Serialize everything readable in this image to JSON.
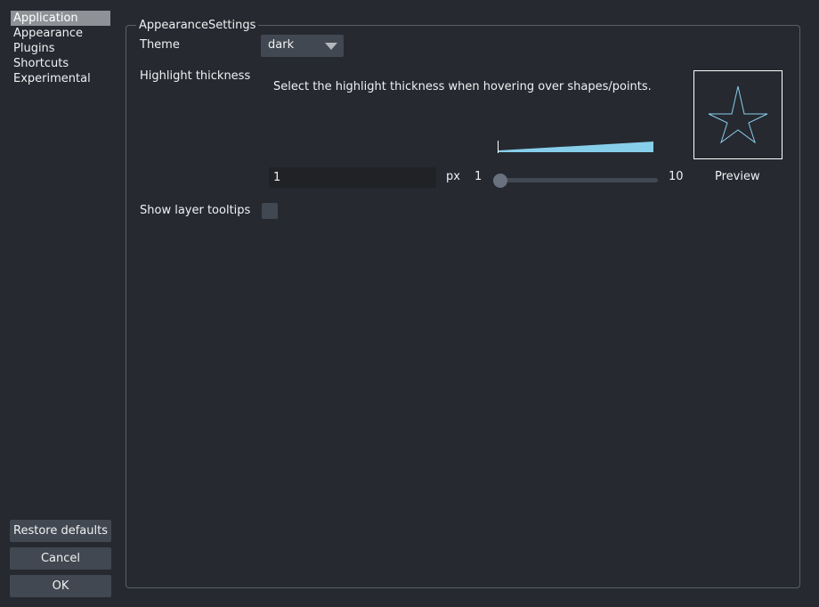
{
  "sidebar": {
    "items": [
      {
        "label": "Application",
        "selected": true
      },
      {
        "label": "Appearance",
        "selected": false
      },
      {
        "label": "Plugins",
        "selected": false
      },
      {
        "label": "Shortcuts",
        "selected": false
      },
      {
        "label": "Experimental",
        "selected": false
      }
    ]
  },
  "buttons": {
    "restore_defaults": "Restore defaults",
    "cancel": "Cancel",
    "ok": "OK"
  },
  "group": {
    "title": "AppearanceSettings",
    "theme": {
      "label": "Theme",
      "value": "dark",
      "icon": "chevron-down-icon"
    },
    "highlight": {
      "label": "Highlight thickness",
      "description": "Select the highlight thickness when hovering over shapes/points.",
      "value": "1",
      "unit": "px",
      "min_label": "1",
      "max_label": "10",
      "min": 1,
      "max": 10,
      "current": 1,
      "preview_label": "Preview",
      "accent_color": "#87ceeb",
      "preview_icon": "star-icon"
    },
    "tooltips": {
      "label": "Show layer tooltips",
      "checked": false
    }
  }
}
